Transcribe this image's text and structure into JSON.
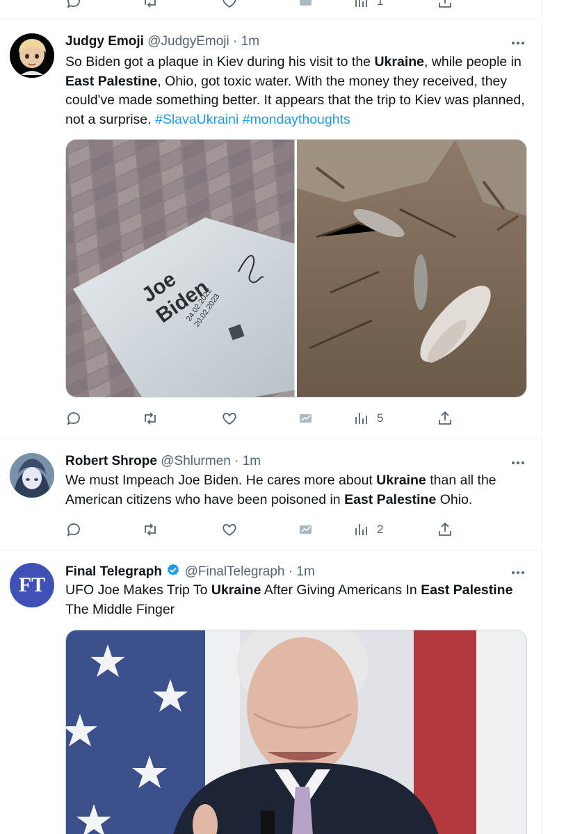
{
  "top_actions": {
    "views": "1"
  },
  "tweets": [
    {
      "name": "Judgy Emoji",
      "handle": "@JudgyEmoji",
      "sep": "·",
      "time": "1m",
      "text_parts": [
        "So Biden got a plaque in Kiev during his visit to the ",
        "Ukraine",
        ", while people in ",
        "East Palestine",
        ", Ohio, got toxic water. With the money they received, they could've made something better. It appears that the trip to Kiev was planned, not a surprise. ",
        "#SlavaUkraini",
        "  ",
        "#mondaythoughts"
      ],
      "plaque": {
        "line1": "Joe",
        "line2": "Biden",
        "date1": "24.02.2022",
        "date2": "20.02.2023"
      },
      "views": "5"
    },
    {
      "name": "Robert Shrope",
      "handle": "@Shlurmen",
      "sep": "·",
      "time": "1m",
      "text_parts": [
        "We must Impeach Joe Biden. He cares more about ",
        "Ukraine",
        " than all the American citizens who have been poisoned in ",
        "East Palestine",
        " Ohio."
      ],
      "views": "2"
    },
    {
      "name": "Final Telegraph",
      "handle": "@FinalTelegraph",
      "sep": "·",
      "time": "1m",
      "avatar_text": "FT",
      "text_parts": [
        "UFO Joe Makes Trip To ",
        "Ukraine",
        " After Giving Americans In ",
        "East Palestine",
        " The Middle Finger"
      ]
    }
  ],
  "colors": {
    "link": "#1d9bf0",
    "muted": "#536471",
    "border": "#eff3f4",
    "verified": "#1d9bf0"
  },
  "icons": [
    "reply-icon",
    "retweet-icon",
    "like-icon",
    "analytics-icon",
    "views-icon",
    "share-icon",
    "more-icon",
    "verified-icon"
  ]
}
